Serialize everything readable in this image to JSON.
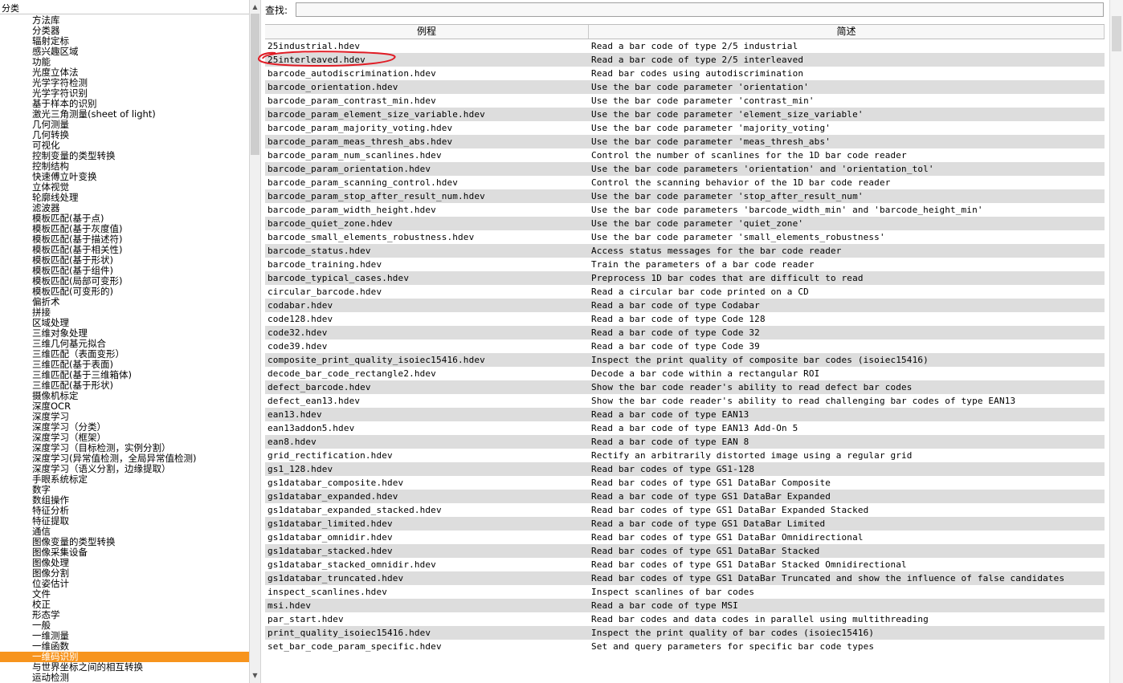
{
  "left_panel": {
    "header": "分类",
    "categories": [
      "方法库",
      "分类器",
      "辐射定标",
      "感兴趣区域",
      "功能",
      "光度立体法",
      "光学字符检测",
      "光学字符识别",
      "基于样本的识别",
      "激光三角测量(sheet of light)",
      "几何测量",
      "几何转换",
      "可视化",
      "控制变量的类型转换",
      "控制结构",
      "快速傅立叶变换",
      "立体视觉",
      "轮廓线处理",
      "滤波器",
      "模板匹配(基于点)",
      "模板匹配(基于灰度值)",
      "模板匹配(基于描述符)",
      "模板匹配(基于相关性)",
      "模板匹配(基于形状)",
      "模板匹配(基于组件)",
      "模板匹配(局部可变形)",
      "模板匹配(可变形的)",
      "偏折术",
      "拼接",
      "区域处理",
      "三维对象处理",
      "三维几何基元拟合",
      "三维匹配（表面变形）",
      "三维匹配(基于表面)",
      "三维匹配(基于三维箱体)",
      "三维匹配(基于形状)",
      "摄像机标定",
      "深度OCR",
      "深度学习",
      "深度学习（分类）",
      "深度学习（框架）",
      "深度学习（目标检测，实例分割）",
      "深度学习(异常值检测，全局异常值检测)",
      "深度学习（语义分割，边缘提取）",
      "手眼系统标定",
      "数字",
      "数组操作",
      "特征分析",
      "特征提取",
      "通信",
      "图像变量的类型转换",
      "图像采集设备",
      "图像处理",
      "图像分割",
      "位姿估计",
      "文件",
      "校正",
      "形态学",
      "一般",
      "一维测量",
      "一维函数",
      "一维码识别",
      "与世界坐标之间的相互转换",
      "运动检测"
    ],
    "selected_index": 61,
    "selected_color": "#f7941d"
  },
  "search": {
    "label": "查找:",
    "value": ""
  },
  "table": {
    "headers": [
      "例程",
      "简述"
    ],
    "rows": [
      [
        "25industrial.hdev",
        "Read a bar code of type 2/5 industrial"
      ],
      [
        "25interleaved.hdev",
        "Read a bar code of type 2/5 interleaved"
      ],
      [
        "barcode_autodiscrimination.hdev",
        "Read bar codes using autodiscrimination"
      ],
      [
        "barcode_orientation.hdev",
        "Use the bar code parameter 'orientation'"
      ],
      [
        "barcode_param_contrast_min.hdev",
        "Use the bar code parameter 'contrast_min'"
      ],
      [
        "barcode_param_element_size_variable.hdev",
        "Use the bar code parameter 'element_size_variable'"
      ],
      [
        "barcode_param_majority_voting.hdev",
        "Use the bar code parameter 'majority_voting'"
      ],
      [
        "barcode_param_meas_thresh_abs.hdev",
        "Use the bar code parameter 'meas_thresh_abs'"
      ],
      [
        "barcode_param_num_scanlines.hdev",
        "Control the number of scanlines for the 1D bar code reader"
      ],
      [
        "barcode_param_orientation.hdev",
        "Use the bar code parameters 'orientation' and 'orientation_tol'"
      ],
      [
        "barcode_param_scanning_control.hdev",
        "Control the scanning behavior of the 1D bar code reader"
      ],
      [
        "barcode_param_stop_after_result_num.hdev",
        "Use the bar code parameter 'stop_after_result_num'"
      ],
      [
        "barcode_param_width_height.hdev",
        "Use the bar code parameters 'barcode_width_min' and 'barcode_height_min'"
      ],
      [
        "barcode_quiet_zone.hdev",
        "Use the bar code parameter 'quiet_zone'"
      ],
      [
        "barcode_small_elements_robustness.hdev",
        "Use the bar code parameter 'small_elements_robustness'"
      ],
      [
        "barcode_status.hdev",
        "Access status messages for the bar code reader"
      ],
      [
        "barcode_training.hdev",
        "Train the parameters of a bar code reader"
      ],
      [
        "barcode_typical_cases.hdev",
        "Preprocess 1D bar codes that are difficult to read"
      ],
      [
        "circular_barcode.hdev",
        "Read a circular bar code printed on a CD"
      ],
      [
        "codabar.hdev",
        "Read a bar code of type Codabar"
      ],
      [
        "code128.hdev",
        "Read a bar code of type Code 128"
      ],
      [
        "code32.hdev",
        "Read a bar code of type Code 32"
      ],
      [
        "code39.hdev",
        "Read a bar code of type Code 39"
      ],
      [
        "composite_print_quality_isoiec15416.hdev",
        "Inspect the print quality of composite bar codes (isoiec15416)"
      ],
      [
        "decode_bar_code_rectangle2.hdev",
        "Decode a bar code within a rectangular ROI"
      ],
      [
        "defect_barcode.hdev",
        "Show the bar code reader's ability to read defect bar codes"
      ],
      [
        "defect_ean13.hdev",
        "Show the bar code reader's ability to read challenging bar codes of type EAN13"
      ],
      [
        "ean13.hdev",
        "Read a bar code of type EAN13"
      ],
      [
        "ean13addon5.hdev",
        "Read a bar code of type EAN13 Add-On 5"
      ],
      [
        "ean8.hdev",
        "Read a bar code of type EAN 8"
      ],
      [
        "grid_rectification.hdev",
        "Rectify an arbitrarily distorted image using a regular grid"
      ],
      [
        "gs1_128.hdev",
        "Read bar codes of type GS1-128"
      ],
      [
        "gs1databar_composite.hdev",
        "Read bar codes of type GS1 DataBar Composite"
      ],
      [
        "gs1databar_expanded.hdev",
        "Read a bar code of type GS1 DataBar Expanded"
      ],
      [
        "gs1databar_expanded_stacked.hdev",
        "Read bar codes of type GS1 DataBar Expanded Stacked"
      ],
      [
        "gs1databar_limited.hdev",
        "Read a bar code of type GS1 DataBar Limited"
      ],
      [
        "gs1databar_omnidir.hdev",
        "Read bar codes of type GS1 DataBar Omnidirectional"
      ],
      [
        "gs1databar_stacked.hdev",
        "Read bar codes of type GS1 DataBar Stacked"
      ],
      [
        "gs1databar_stacked_omnidir.hdev",
        "Read bar codes of type GS1 DataBar Stacked Omnidirectional"
      ],
      [
        "gs1databar_truncated.hdev",
        "Read bar codes of type GS1 DataBar Truncated and show the influence of false candidates"
      ],
      [
        "inspect_scanlines.hdev",
        "Inspect scanlines of bar codes"
      ],
      [
        "msi.hdev",
        "Read a bar code of type MSI"
      ],
      [
        "par_start.hdev",
        "Read bar codes and data codes in parallel using multithreading"
      ],
      [
        "print_quality_isoiec15416.hdev",
        "Inspect the print quality of bar codes (isoiec15416)"
      ],
      [
        "set_bar_code_param_specific.hdev",
        "Set and query parameters for specific bar code types"
      ]
    ],
    "circled_row_index": 1,
    "annotation_color": "#e01b24"
  }
}
